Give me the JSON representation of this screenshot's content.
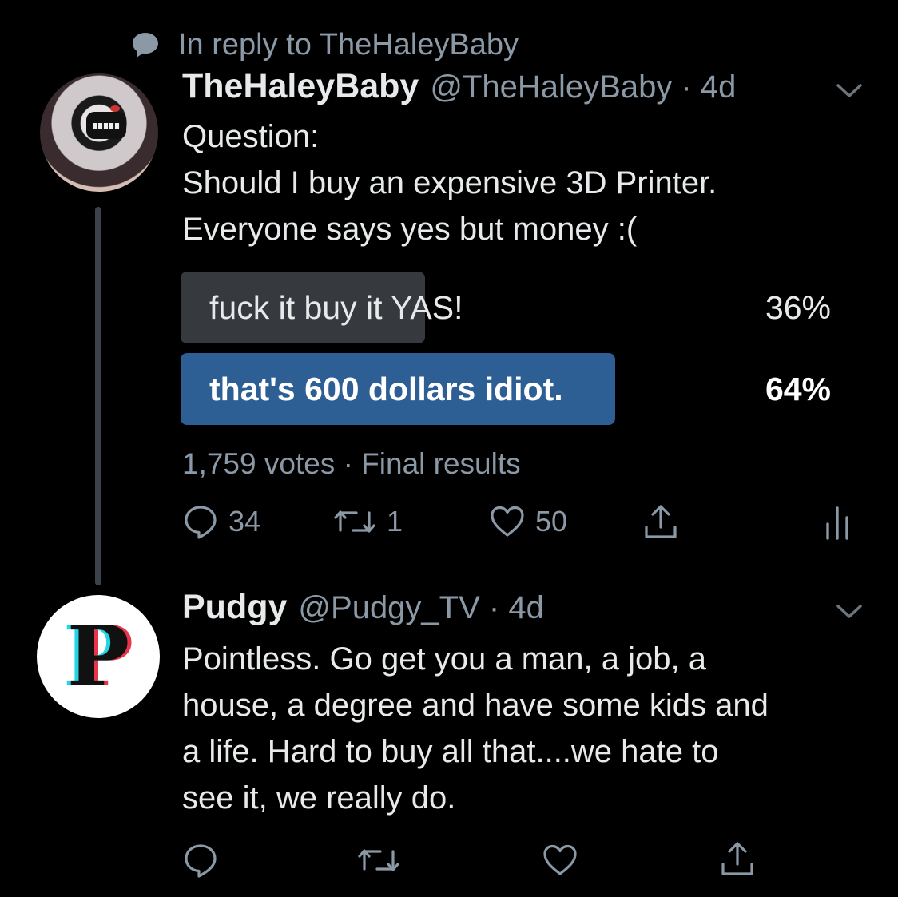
{
  "reply_context": {
    "text": "In reply to TheHaleyBaby",
    "icon": "speech-bubble-icon"
  },
  "tweet1": {
    "display_name": "TheHaleyBaby",
    "handle_time": "@TheHaleyBaby · 4d",
    "body": [
      "Question:",
      "Should I buy an expensive 3D Printer.",
      "Everyone says yes but money :("
    ],
    "poll": {
      "options": [
        {
          "label": "fuck it buy it YAS!",
          "percent": "36%",
          "share": 0.36,
          "winner": false
        },
        {
          "label": "that's 600 dollars idiot.",
          "percent": "64%",
          "share": 0.64,
          "winner": true
        }
      ],
      "meta": "1,759 votes · Final results"
    },
    "actions": {
      "reply_count": "34",
      "retweet_count": "1",
      "like_count": "50"
    }
  },
  "tweet2": {
    "display_name": "Pudgy",
    "handle_time": "@Pudgy_TV · 4d",
    "avatar_letter": "P",
    "body": [
      "Pointless. Go get you a man, a job, a",
      "house, a degree and have some kids and",
      "a life. Hard to buy all that....we hate to",
      "see it, we really do."
    ]
  },
  "colors": {
    "background": "#000000",
    "poll_winner": "#2d5f94",
    "poll_other": "#363a3f",
    "muted": "#8b98a5",
    "thread_line": "#3c4249"
  }
}
